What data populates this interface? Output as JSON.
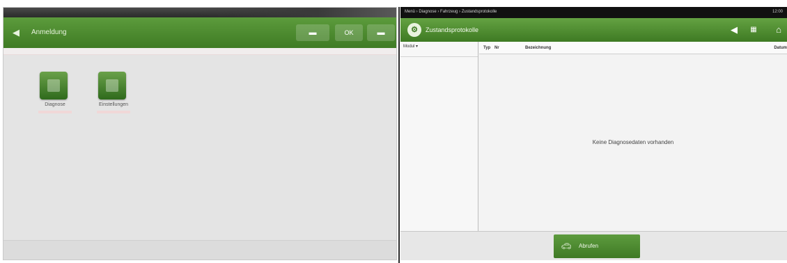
{
  "left_window": {
    "header": {
      "back_icon": "arrow-left-icon",
      "title": "Anmeldung",
      "buttons": [
        {
          "icon": "screen-icon",
          "label": ""
        },
        {
          "icon": "text-icon",
          "label": "OK"
        },
        {
          "icon": "window-icon",
          "label": ""
        }
      ]
    },
    "tiles": [
      {
        "icon": "app-tile-icon",
        "label": "Diagnose"
      },
      {
        "icon": "app-tile-icon",
        "label": "Einstellungen"
      }
    ]
  },
  "right_window": {
    "statusbar": {
      "path": "Menü › Diagnose › Fahrzeug › Zustandsprotokolle",
      "clock": "12:00"
    },
    "header": {
      "logo_icon": "settings-circle-icon",
      "title": "Zustandsprotokolle",
      "icons": [
        "arrow-left-icon",
        "grid-icon",
        "home-icon"
      ]
    },
    "left_column": {
      "header": "Modul ▾"
    },
    "table": {
      "columns": [
        "Typ",
        "Nr",
        "Bezeichnung",
        "Datum"
      ],
      "empty_message": "Keine Diagnosedaten vorhanden"
    },
    "footer": {
      "button_icon": "car-signal-icon",
      "button_label": "Abrufen"
    }
  },
  "colors": {
    "header_green": "#4a8a2e",
    "background": "#e4e4e4",
    "status_bar": "#111111"
  }
}
